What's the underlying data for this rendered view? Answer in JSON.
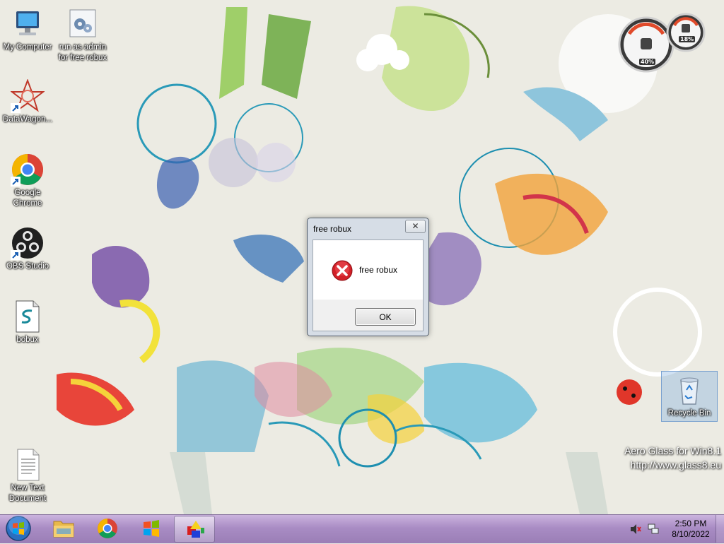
{
  "desktop": {
    "icons": [
      {
        "label": "My Computer",
        "icon": "computer-icon"
      },
      {
        "label": "run as admin for free robux",
        "icon": "script-gear-icon"
      },
      {
        "label": "DataWagon...",
        "icon": "datawagon-icon"
      },
      {
        "label": "Google Chrome",
        "icon": "chrome-icon"
      },
      {
        "label": "OBS Studio",
        "icon": "obs-icon"
      },
      {
        "label": "bobux",
        "icon": "script-file-icon"
      },
      {
        "label": "New Text Document",
        "icon": "text-document-icon"
      },
      {
        "label": "Recycle Bin",
        "icon": "recycle-bin-icon"
      }
    ]
  },
  "gadget": {
    "cpu": "40%",
    "memory": "18%"
  },
  "dialog": {
    "title": "free robux",
    "message": "free robux",
    "ok_label": "OK",
    "close_glyph": "✕"
  },
  "watermark": {
    "line1": "Aero Glass for Win8.1",
    "line2": "http://www.glass8.eu"
  },
  "taskbar": {
    "buttons": [
      {
        "name": "start-orb",
        "icon": "windows-orb-icon"
      },
      {
        "name": "file-explorer",
        "icon": "folder-icon"
      },
      {
        "name": "google-chrome",
        "icon": "chrome-icon"
      },
      {
        "name": "windows",
        "icon": "windows-logo-icon"
      },
      {
        "name": "app",
        "icon": "app-shapes-icon"
      }
    ],
    "clock": {
      "time": "2:50 PM",
      "date": "8/10/2022"
    },
    "accent": "#a98cc4"
  }
}
